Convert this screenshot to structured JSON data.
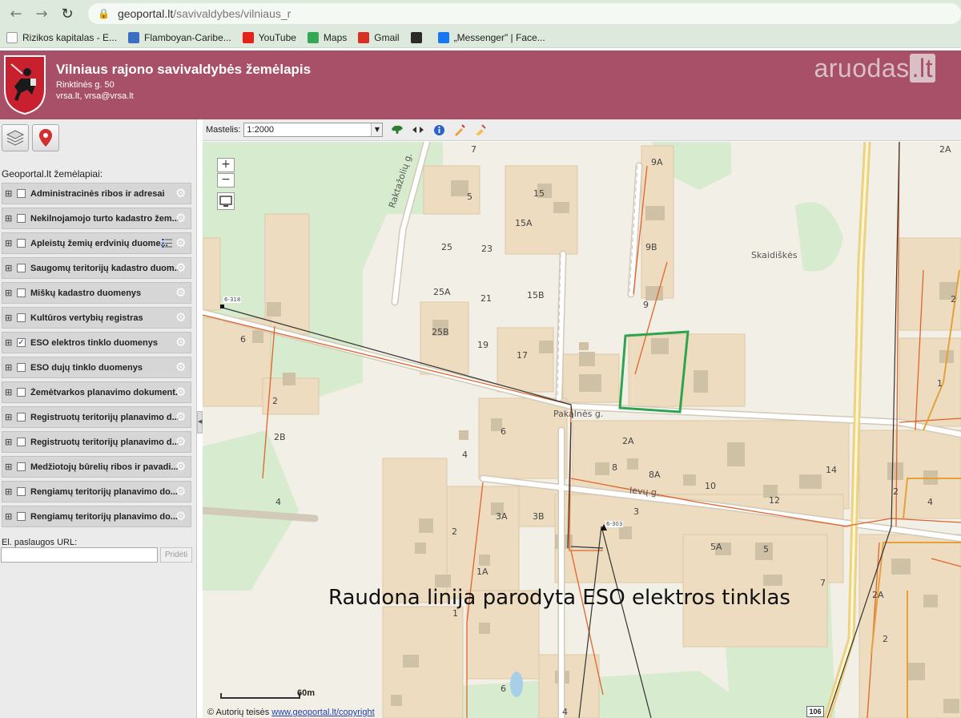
{
  "browser": {
    "url_host": "geoportal.lt",
    "url_path": "/savivaldybes/vilniaus_r",
    "bookmarks": [
      {
        "label": "Rizikos kapitalas - E...",
        "icon": "blank-page-icon",
        "color": "#ffffff"
      },
      {
        "label": "Flamboyan-Caribe...",
        "icon": "globe-icon",
        "color": "#3b6fc4"
      },
      {
        "label": "YouTube",
        "icon": "youtube-icon",
        "color": "#e62117"
      },
      {
        "label": "Maps",
        "icon": "maps-pin-icon",
        "color": "#34a853"
      },
      {
        "label": "Gmail",
        "icon": "gmail-icon",
        "color": "#d93025"
      },
      {
        "label": "",
        "icon": "l-logo-icon",
        "color": "#2b2b2b"
      },
      {
        "label": "„Messenger\" | Face...",
        "icon": "facebook-icon",
        "color": "#1877f2"
      }
    ]
  },
  "header": {
    "title": "Vilniaus rajono savivaldybės žemėlapis",
    "address": "Rinktinės g. 50",
    "contact": "vrsa.lt, vrsa@vrsa.lt",
    "watermark_text": "aruodas",
    "watermark_suffix": ".lt",
    "bg_color": "#a75067"
  },
  "sidebar": {
    "heading": "Geoportal.lt žemėlapiai:",
    "layers": [
      {
        "label": "Administracinės ribos ir adresai",
        "checked": false,
        "has_legend": false
      },
      {
        "label": "Nekilnojamojo turto kadastro žem...",
        "checked": false,
        "has_legend": false
      },
      {
        "label": "Apleistų žemių erdvinių duome...",
        "checked": false,
        "has_legend": true
      },
      {
        "label": "Saugomų teritorijų kadastro duom...",
        "checked": false,
        "has_legend": false
      },
      {
        "label": "Miškų kadastro duomenys",
        "checked": false,
        "has_legend": false
      },
      {
        "label": "Kultūros vertybių registras",
        "checked": false,
        "has_legend": false
      },
      {
        "label": "ESO elektros tinklo duomenys",
        "checked": true,
        "has_legend": false
      },
      {
        "label": "ESO dujų tinklo duomenys",
        "checked": false,
        "has_legend": false
      },
      {
        "label": "Žemėtvarkos planavimo dokument...",
        "checked": false,
        "has_legend": false
      },
      {
        "label": "Registruotų teritorijų planavimo d...",
        "checked": false,
        "has_legend": false
      },
      {
        "label": "Registruotų teritorijų planavimo d...",
        "checked": false,
        "has_legend": false
      },
      {
        "label": "Medžiotojų būrelių ribos ir pavadi...",
        "checked": false,
        "has_legend": false
      },
      {
        "label": "Rengiamų teritorijų planavimo do...",
        "checked": false,
        "has_legend": false
      },
      {
        "label": "Rengiamų teritorijų planavimo do...",
        "checked": false,
        "has_legend": false
      }
    ],
    "url_label": "El. paslaugos URL:",
    "url_value": "",
    "url_button": "Pridėti"
  },
  "toolbar": {
    "scale_label": "Mastelis:",
    "scale_value": "1:2000"
  },
  "map": {
    "annotation": "Raudona linija parodyta ESO elektros tinklas",
    "scalebar_label": "60m",
    "copyright_prefix": "© Autorių teisės ",
    "copyright_link": "www.geoportal.lt/copyright",
    "place_name": "Skaidiškės",
    "streets": {
      "raktazoliu": "Raktažolių g.",
      "pakalnes": "Pakalnės g.",
      "ievu": "Ievų g."
    },
    "point_labels": {
      "p1": "6-318",
      "p2": "6-303"
    },
    "road_number": "106",
    "house_numbers": {
      "h7": "7",
      "h5a": "5",
      "h15": "15",
      "h15a": "15A",
      "h25": "25",
      "h23": "23",
      "h25a": "25A",
      "h21": "21",
      "h15b": "15B",
      "h25b": "25B",
      "h19": "19",
      "h17": "17",
      "h9a": "9A",
      "h9b": "9B",
      "h9": "9",
      "h2a_top": "2A",
      "h6": "6",
      "h2": "2",
      "h2b": "2B",
      "h4": "4",
      "h6b": "6",
      "h4b": "4",
      "h2a": "2A",
      "h8": "8",
      "h8a": "8A",
      "h10": "10",
      "h14": "14",
      "h12": "12",
      "h3": "3",
      "h3a": "3A",
      "h3b": "3B",
      "h2c": "2",
      "h1a": "1A",
      "h1": "1",
      "h5a2": "5A",
      "h5": "5",
      "h7b": "7",
      "h6c": "6",
      "h4c": "4",
      "h1r": "1",
      "h2r": "2",
      "h4r": "4",
      "h2ar": "2A",
      "h2r2": "2",
      "h2d": "2"
    },
    "selection_color": "#2ea44f",
    "power_line_color": "#e0642a"
  }
}
